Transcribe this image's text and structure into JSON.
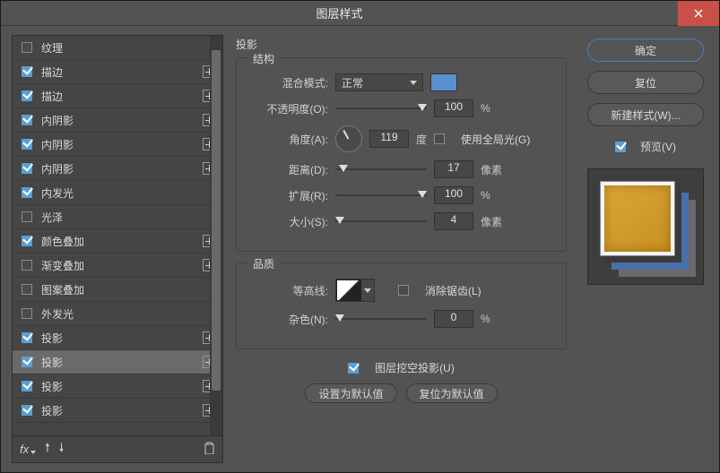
{
  "window": {
    "title": "图层样式"
  },
  "styles": [
    {
      "label": "纹理",
      "checked": false,
      "add": false
    },
    {
      "label": "描边",
      "checked": true,
      "add": true
    },
    {
      "label": "描边",
      "checked": true,
      "add": true
    },
    {
      "label": "内阴影",
      "checked": true,
      "add": true
    },
    {
      "label": "内阴影",
      "checked": true,
      "add": true
    },
    {
      "label": "内阴影",
      "checked": true,
      "add": true
    },
    {
      "label": "内发光",
      "checked": true,
      "add": false
    },
    {
      "label": "光泽",
      "checked": false,
      "add": false
    },
    {
      "label": "颜色叠加",
      "checked": true,
      "add": true
    },
    {
      "label": "渐变叠加",
      "checked": false,
      "add": true
    },
    {
      "label": "图案叠加",
      "checked": false,
      "add": false
    },
    {
      "label": "外发光",
      "checked": false,
      "add": false
    },
    {
      "label": "投影",
      "checked": true,
      "add": true
    },
    {
      "label": "投影",
      "checked": true,
      "add": true,
      "selected": true
    },
    {
      "label": "投影",
      "checked": true,
      "add": true
    },
    {
      "label": "投影",
      "checked": true,
      "add": true
    }
  ],
  "panel": {
    "title": "投影",
    "structure": {
      "legend": "结构",
      "blend_label": "混合模式:",
      "blend_value": "正常",
      "opacity_label": "不透明度(O):",
      "opacity_value": "100",
      "opacity_unit": "%",
      "angle_label": "角度(A):",
      "angle_value": "119",
      "angle_unit": "度",
      "global_label": "使用全局光(G)",
      "global_checked": false,
      "distance_label": "距离(D):",
      "distance_value": "17",
      "distance_unit": "像素",
      "spread_label": "扩展(R):",
      "spread_value": "100",
      "spread_unit": "%",
      "size_label": "大小(S):",
      "size_value": "4",
      "size_unit": "像素"
    },
    "quality": {
      "legend": "品质",
      "contour_label": "等高线:",
      "antialias_label": "消除锯齿(L)",
      "antialias_checked": false,
      "noise_label": "杂色(N):",
      "noise_value": "0",
      "noise_unit": "%"
    },
    "knockout_label": "图层挖空投影(U)",
    "knockout_checked": true,
    "make_default": "设置为默认值",
    "reset_default": "复位为默认值"
  },
  "actions": {
    "ok": "确定",
    "reset": "复位",
    "new_style": "新建样式(W)...",
    "preview_label": "预览(V)",
    "preview_checked": true
  },
  "footer": {
    "fx": "fx"
  }
}
